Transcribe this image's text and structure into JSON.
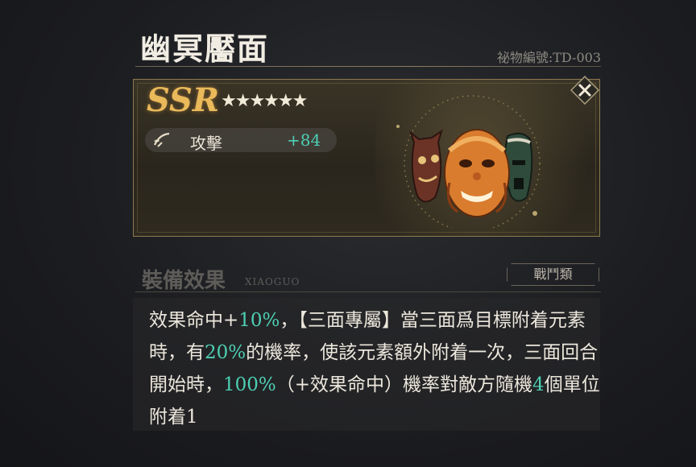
{
  "header": {
    "title": "幽冥靨面",
    "serial": "祕物編號:TD-003"
  },
  "card": {
    "rarity": "SSR",
    "stars": "★★★★★★",
    "star_count": 6,
    "stat": {
      "label": "攻擊",
      "value": "+84"
    }
  },
  "effect": {
    "title": "裝備效果",
    "subtitle": "XIAOGUO",
    "category": "戰鬥類",
    "segments": [
      {
        "t": "效果命中+",
        "hl": false
      },
      {
        "t": "10%",
        "hl": true
      },
      {
        "t": "，【三面專屬】當三面爲目標附着元素時，有",
        "hl": false
      },
      {
        "t": "20%",
        "hl": true
      },
      {
        "t": "的機率，使該元素額外附着一次，三面回合開始時，",
        "hl": false
      },
      {
        "t": "100%",
        "hl": true
      },
      {
        "t": "（+效果命中）機率對敵方隨機",
        "hl": false
      },
      {
        "t": "4",
        "hl": true
      },
      {
        "t": "個單位附着1",
        "hl": false
      }
    ]
  },
  "colors": {
    "highlight": "#4dcfb3",
    "rarity": "#e9b95a",
    "border": "#8b7a4e"
  },
  "icons": {
    "stat": "claw-slash-icon",
    "close": "close-icon"
  }
}
